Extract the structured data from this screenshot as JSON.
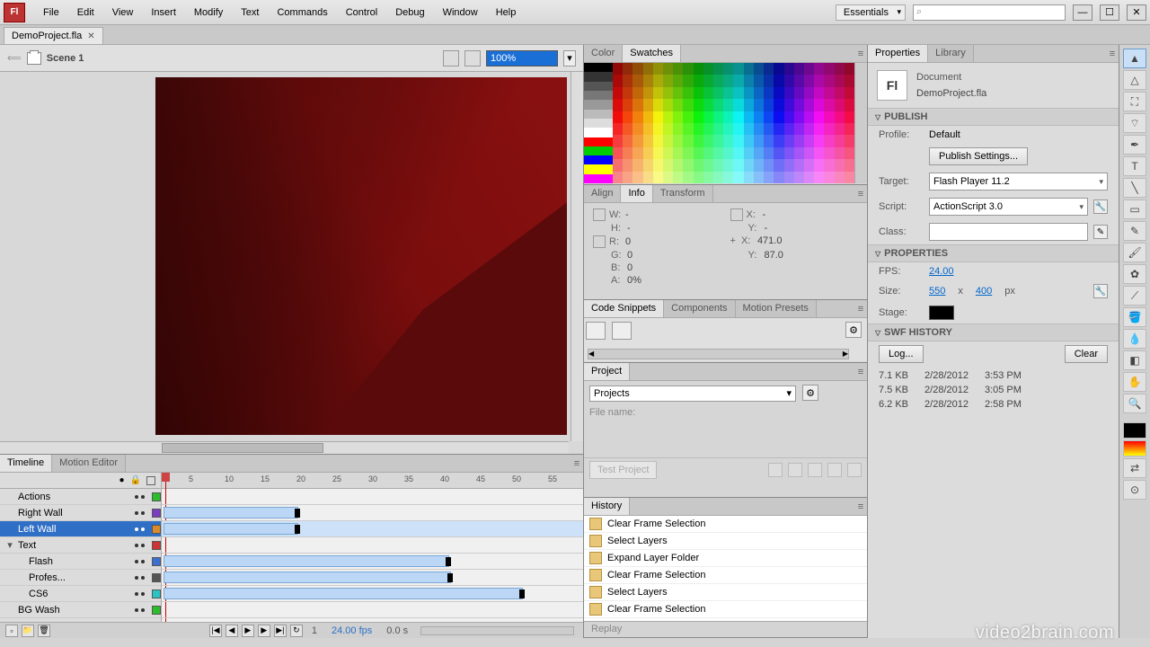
{
  "menus": [
    "File",
    "Edit",
    "View",
    "Insert",
    "Modify",
    "Text",
    "Commands",
    "Control",
    "Debug",
    "Window",
    "Help"
  ],
  "workspace": "Essentials",
  "search_placeholder": "",
  "doc_tab": "DemoProject.fla",
  "scene": "Scene 1",
  "zoom": "100%",
  "mid": {
    "color_tabs": [
      "Color",
      "Swatches"
    ],
    "info_tabs": [
      "Align",
      "Info",
      "Transform"
    ],
    "info": {
      "W": "-",
      "H": "-",
      "X": "-",
      "Y": "-",
      "R": "0",
      "G": "0",
      "B": "0",
      "A": "0%",
      "plusX": "471.0",
      "plusY": "87.0"
    },
    "snippets_tabs": [
      "Code Snippets",
      "Components",
      "Motion Presets"
    ],
    "project_tab": "Project",
    "project_dd": "Projects",
    "file_name_label": "File name:",
    "test_project": "Test Project",
    "history_tab": "History",
    "history": [
      "Clear Frame Selection",
      "Select Layers",
      "Expand Layer Folder",
      "Clear Frame Selection",
      "Select Layers",
      "Clear Frame Selection"
    ],
    "replay": "Replay"
  },
  "props": {
    "tabs": [
      "Properties",
      "Library"
    ],
    "doc_type": "Document",
    "doc_name": "DemoProject.fla",
    "publish": "PUBLISH",
    "profile_lbl": "Profile:",
    "profile_val": "Default",
    "publish_settings": "Publish Settings...",
    "target_lbl": "Target:",
    "target_val": "Flash Player 11.2",
    "script_lbl": "Script:",
    "script_val": "ActionScript 3.0",
    "class_lbl": "Class:",
    "properties": "PROPERTIES",
    "fps_lbl": "FPS:",
    "fps_val": "24.00",
    "size_lbl": "Size:",
    "size_w": "550",
    "size_h": "400",
    "size_unit": "px",
    "stage_lbl": "Stage:",
    "swf": "SWF HISTORY",
    "log": "Log...",
    "clear": "Clear",
    "swf_rows": [
      {
        "size": "7.1 KB",
        "date": "2/28/2012",
        "time": "3:53 PM"
      },
      {
        "size": "7.5 KB",
        "date": "2/28/2012",
        "time": "3:05 PM"
      },
      {
        "size": "6.2 KB",
        "date": "2/28/2012",
        "time": "2:58 PM"
      }
    ]
  },
  "timeline": {
    "tabs": [
      "Timeline",
      "Motion Editor"
    ],
    "ticks": [
      5,
      10,
      15,
      20,
      25,
      30,
      35,
      40,
      45,
      50,
      55
    ],
    "layers": [
      {
        "name": "Actions",
        "color": "#2bbd2b",
        "indent": 0,
        "fold": ""
      },
      {
        "name": "Right Wall",
        "color": "#7a3fbf",
        "indent": 0,
        "fold": ""
      },
      {
        "name": "Left Wall",
        "color": "#d98b2b",
        "indent": 0,
        "fold": "",
        "sel": true
      },
      {
        "name": "Text",
        "color": "#c33",
        "indent": 0,
        "fold": "▾"
      },
      {
        "name": "Flash",
        "color": "#3a6fd0",
        "indent": 1,
        "fold": ""
      },
      {
        "name": "Profes...",
        "color": "#555",
        "indent": 1,
        "fold": ""
      },
      {
        "name": "CS6",
        "color": "#2bc3c3",
        "indent": 1,
        "fold": ""
      },
      {
        "name": "BG Wash",
        "color": "#2bbd2b",
        "indent": 0,
        "fold": ""
      }
    ],
    "frame": "1",
    "fps": "24.00 fps",
    "time": "0.0 s"
  },
  "watermark": "video2brain.com"
}
